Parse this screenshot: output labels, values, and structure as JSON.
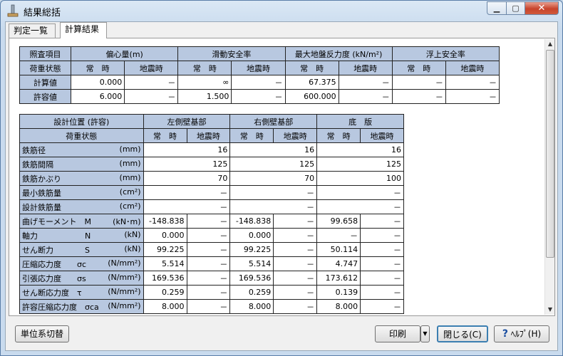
{
  "window": {
    "title": "結果総括"
  },
  "tabs": [
    {
      "label": "判定一覧"
    },
    {
      "label": "計算結果"
    }
  ],
  "stability_table": {
    "header": {
      "item_label": "照査項目",
      "groups": [
        "偏心量(m)",
        "滑動安全率",
        "最大地盤反力度 (kN/m²)",
        "浮上安全率"
      ],
      "load_label": "荷重状態",
      "normal": "常　時",
      "seismic": "地震時"
    },
    "rows": [
      {
        "label": "計算値",
        "cells": [
          "0.000",
          "－",
          "∞",
          "－",
          "67.375",
          "－",
          "－",
          "－"
        ]
      },
      {
        "label": "許容値",
        "cells": [
          "6.000",
          "－",
          "1.500",
          "－",
          "600.000",
          "－",
          "－",
          "－"
        ]
      }
    ]
  },
  "rebar_table": {
    "header": {
      "position_label": "設計位置 (許容)",
      "groups": [
        "左側壁基部",
        "右側壁基部",
        "底　版"
      ],
      "load_label": "荷重状態",
      "normal": "常　時",
      "seismic": "地震時"
    },
    "rows": [
      {
        "label": "鉄筋径",
        "unit": "(mm)",
        "cells": [
          "16",
          "16",
          "16"
        ]
      },
      {
        "label": "鉄筋間隔",
        "unit": "(mm)",
        "cells": [
          "125",
          "125",
          "125"
        ]
      },
      {
        "label": "鉄筋かぶり",
        "unit": "(mm)",
        "cells": [
          "70",
          "70",
          "100"
        ]
      },
      {
        "label": "最小鉄筋量",
        "unit": "(cm²)",
        "cells": [
          "－",
          "－",
          "－"
        ]
      },
      {
        "label": "設計鉄筋量",
        "unit": "(cm²)",
        "cells": [
          "－",
          "－",
          "－"
        ]
      },
      {
        "label": "曲げモーメント　M",
        "unit": "(kN･m)",
        "cells": [
          "-148.838",
          "－",
          "-148.838",
          "－",
          "99.658",
          "－"
        ]
      },
      {
        "label": "軸力　　　　　　N",
        "unit": "(kN)",
        "cells": [
          "0.000",
          "－",
          "0.000",
          "－",
          "－",
          "－"
        ]
      },
      {
        "label": "せん断力　　　　S",
        "unit": "(kN)",
        "cells": [
          "99.225",
          "－",
          "99.225",
          "－",
          "50.114",
          "－"
        ]
      },
      {
        "label": "圧縮応力度　　σc",
        "unit": "(N/mm²)",
        "cells": [
          "5.514",
          "－",
          "5.514",
          "－",
          "4.747",
          "－"
        ]
      },
      {
        "label": "引張応力度　　σs",
        "unit": "(N/mm²)",
        "cells": [
          "169.536",
          "－",
          "169.536",
          "－",
          "173.612",
          "－"
        ]
      },
      {
        "label": "せん断応力度　τ",
        "unit": "(N/mm²)",
        "cells": [
          "0.259",
          "－",
          "0.259",
          "－",
          "0.139",
          "－"
        ]
      },
      {
        "label": "許容圧縮応力度　σca",
        "unit": "(N/mm²)",
        "cells": [
          "8.000",
          "－",
          "8.000",
          "－",
          "8.000",
          "－"
        ]
      }
    ]
  },
  "buttons": {
    "unit_switch": "単位系切替",
    "print": "印刷",
    "close": "閉じる(C)",
    "help": "ﾍﾙﾌﾟ(H)"
  }
}
